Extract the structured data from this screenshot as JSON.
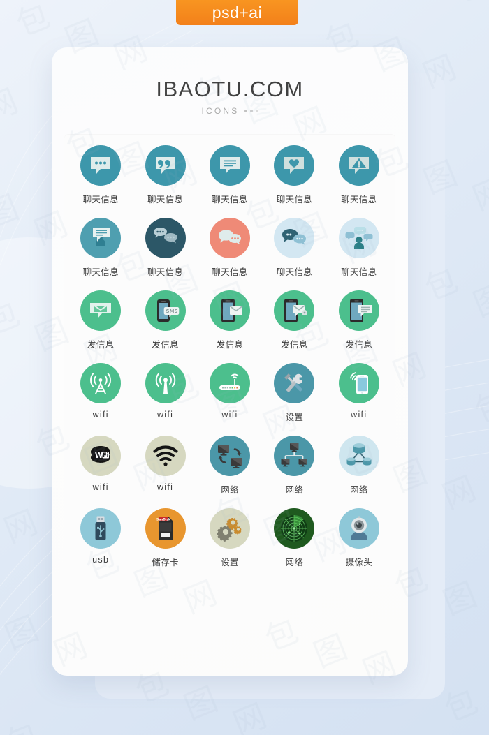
{
  "badge": {
    "label": "psd+ai"
  },
  "header": {
    "title": "IBAOTU.COM",
    "subtitle": "ICONS"
  },
  "grid": {
    "rows": 6,
    "cols": 5,
    "items": [
      {
        "label": "聊天信息",
        "icon": "chat-bubble-dots-icon",
        "bg": "#3d97ab",
        "fg": "#dfeceb"
      },
      {
        "label": "聊天信息",
        "icon": "chat-bubble-quote-icon",
        "bg": "#3d97ab",
        "fg": "#dfeceb"
      },
      {
        "label": "聊天信息",
        "icon": "chat-bubble-lines-icon",
        "bg": "#3d97ab",
        "fg": "#dfeceb"
      },
      {
        "label": "聊天信息",
        "icon": "chat-bubble-heart-icon",
        "bg": "#3d97ab",
        "fg": "#cfe0de"
      },
      {
        "label": "聊天信息",
        "icon": "chat-bubble-warning-icon",
        "bg": "#3d97ab",
        "fg": "#cfe0de"
      },
      {
        "label": "聊天信息",
        "icon": "chat-bubble-person-icon",
        "bg": "#4f9fb0",
        "fg": "#e7f1f0"
      },
      {
        "label": "聊天信息",
        "icon": "chat-two-bubbles-dark-icon",
        "bg": "#2c5767",
        "fg": "#b9cfd6"
      },
      {
        "label": "聊天信息",
        "icon": "chat-two-bubbles-coral-icon",
        "bg": "#ef8a77",
        "fg": "#dfeceb"
      },
      {
        "label": "聊天信息",
        "icon": "chat-bubbles-pair-icon",
        "bg": "#d3e7f2",
        "fg": "#2f6273"
      },
      {
        "label": "聊天信息",
        "icon": "chat-person-three-bubbles-icon",
        "bg": "#d3e7f2",
        "fg": "#2b7f86"
      },
      {
        "label": "发信息",
        "icon": "envelope-bubble-icon",
        "bg": "#4cbf8d",
        "fg": "#e2f2ec"
      },
      {
        "label": "发信息",
        "icon": "phone-sms-icon",
        "bg": "#4cbf8d",
        "fg": "#6fa8bf"
      },
      {
        "label": "发信息",
        "icon": "phone-envelope-icon",
        "bg": "#4cbf8d",
        "fg": "#6fa8bf"
      },
      {
        "label": "发信息",
        "icon": "phone-envelope-badge-icon",
        "bg": "#4cbf8d",
        "fg": "#6fa8bf"
      },
      {
        "label": "发信息",
        "icon": "phone-message-lines-icon",
        "bg": "#4cbf8d",
        "fg": "#6fa8bf"
      },
      {
        "label": "wifi",
        "icon": "radio-tower-icon",
        "bg": "#4cbf8d",
        "fg": "#ffffff"
      },
      {
        "label": "wifi",
        "icon": "antenna-signal-icon",
        "bg": "#4cbf8d",
        "fg": "#ffffff"
      },
      {
        "label": "wifi",
        "icon": "wifi-router-icon",
        "bg": "#4cbf8d",
        "fg": "#ffffff"
      },
      {
        "label": "设置",
        "icon": "wrench-screwdriver-icon",
        "bg": "#4b97a8",
        "fg": "#d9dde0"
      },
      {
        "label": "wifi",
        "icon": "phone-wifi-icon",
        "bg": "#4cbf8d",
        "fg": "#ffffff"
      },
      {
        "label": "wifi",
        "icon": "wifi-logo-icon",
        "bg": "#d6d8c0",
        "fg": "#141414"
      },
      {
        "label": "wifi",
        "icon": "wifi-waves-icon",
        "bg": "#d6d8c0",
        "fg": "#141414"
      },
      {
        "label": "网络",
        "icon": "two-monitors-sync-icon",
        "bg": "#4b97a8",
        "fg": "#3a3a3a"
      },
      {
        "label": "网络",
        "icon": "monitor-network-tree-icon",
        "bg": "#4b97a8",
        "fg": "#3a3a3a"
      },
      {
        "label": "网络",
        "icon": "database-cluster-icon",
        "bg": "#cfe6ef",
        "fg": "#4b97a8"
      },
      {
        "label": "usb",
        "icon": "usb-flash-drive-icon",
        "bg": "#8ec8d8",
        "fg": "#2f4a5c"
      },
      {
        "label": "储存卡",
        "icon": "sd-card-icon",
        "bg": "#e8962f",
        "fg": "#2b2b2b"
      },
      {
        "label": "设置",
        "icon": "gears-icon",
        "bg": "#d6d8c0",
        "fg": "#808070"
      },
      {
        "label": "网络",
        "icon": "radar-screen-icon",
        "bg": "#1f5a1f",
        "fg": "#6fd46f"
      },
      {
        "label": "摄像头",
        "icon": "webcam-icon",
        "bg": "#8ec8d8",
        "fg": "#4f7a96"
      }
    ]
  },
  "watermark": {
    "text": "包图网"
  },
  "colors": {
    "page_bg": "#e3ecf7",
    "card_bg": "#fcfcfc",
    "card_back_bg": "#e4ecf7",
    "badge_orange": "#f3801a",
    "title_text": "#414141",
    "label_text": "#3d3d3d"
  }
}
